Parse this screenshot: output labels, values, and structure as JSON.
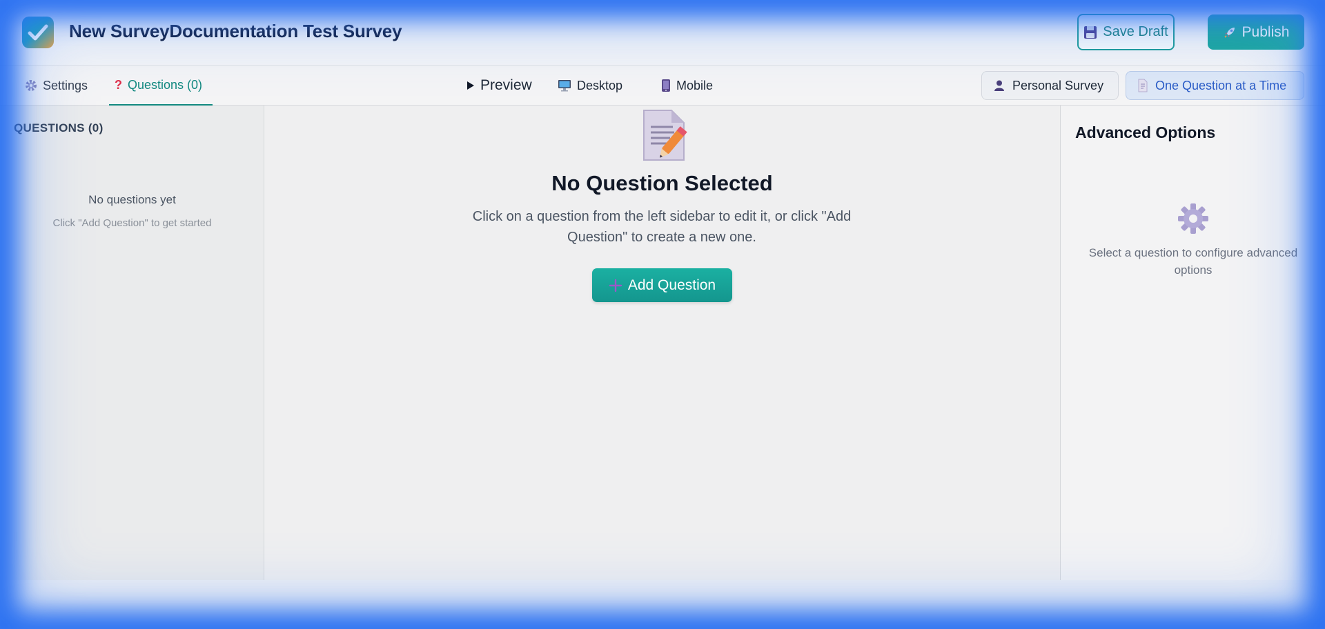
{
  "header": {
    "title": "New SurveyDocumentation Test Survey",
    "save_draft_label": "Save Draft",
    "publish_label": "Publish"
  },
  "toolbar": {
    "tabs": [
      {
        "label": "Settings",
        "icon": "gear-icon"
      },
      {
        "label": "Questions (0)",
        "icon": "question-mark-icon",
        "active": true
      }
    ],
    "preview_label": "Preview",
    "desktop_label": "Desktop",
    "mobile_label": "Mobile",
    "survey_type_label": "Personal Survey",
    "display_mode_label": "One Question at a Time"
  },
  "sidebar": {
    "heading": "QUESTIONS (0)",
    "empty_title": "No questions yet",
    "empty_hint": "Click \"Add Question\" to get started"
  },
  "main": {
    "title": "No Question Selected",
    "description": "Click on a question from the left sidebar to edit it, or click \"Add Question\" to create a new one.",
    "add_button_label": "Add Question"
  },
  "right_panel": {
    "title": "Advanced Options",
    "description": "Select a question to configure advanced options"
  },
  "colors": {
    "accent": "#1aa79d",
    "frame_glow": "#2f6fe8",
    "active_tab": "#12897f",
    "display_mode_text": "#2b5cc6"
  }
}
